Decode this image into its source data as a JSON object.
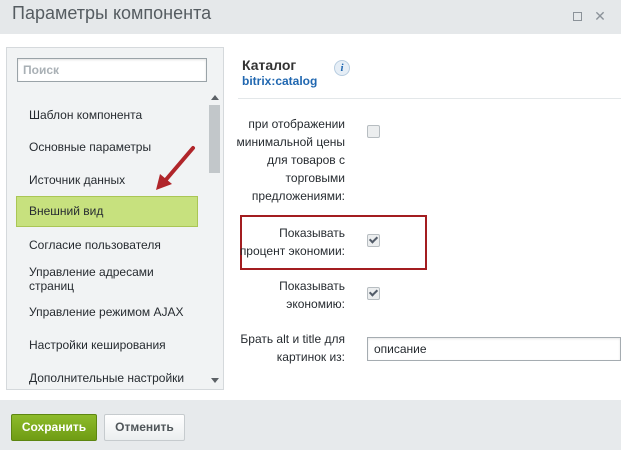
{
  "window": {
    "title": "Параметры компонента",
    "controls": {
      "maximize_icon": "maximize-icon",
      "close_glyph": "✕"
    }
  },
  "sidebar": {
    "search_placeholder": "Поиск",
    "items": [
      {
        "label": "Шаблон компонента",
        "active": false
      },
      {
        "label": "Основные параметры",
        "active": false
      },
      {
        "label": "Источник данных",
        "active": false
      },
      {
        "label": "Внешний вид",
        "active": true
      },
      {
        "label": "Согласие пользователя",
        "active": false
      },
      {
        "label": "Управление адресами страниц",
        "active": false
      },
      {
        "label": "Управление режимом AJAX",
        "active": false
      },
      {
        "label": "Настройки кеширования",
        "active": false
      },
      {
        "label": "Дополнительные настройки",
        "active": false
      }
    ]
  },
  "component": {
    "title": "Каталог",
    "code": "bitrix:catalog",
    "info_icon": "i"
  },
  "options": [
    {
      "label": "при отображении минимальной цены для товаров с торговыми предложениями:",
      "checked": false
    },
    {
      "label": "Показывать процент экономии:",
      "checked": true,
      "highlighted": true
    },
    {
      "label": "Показывать экономию:",
      "checked": true
    },
    {
      "label": "Брать alt и title для картинок из:",
      "value": "описание"
    }
  ],
  "footer": {
    "save_label": "Сохранить",
    "cancel_label": "Отменить"
  },
  "colors": {
    "active_item_bg": "#c7e17e",
    "highlight_border": "#a31d20",
    "arrow": "#b0252a",
    "save_button": "#7aab1f",
    "link_blue": "#2067b0"
  }
}
